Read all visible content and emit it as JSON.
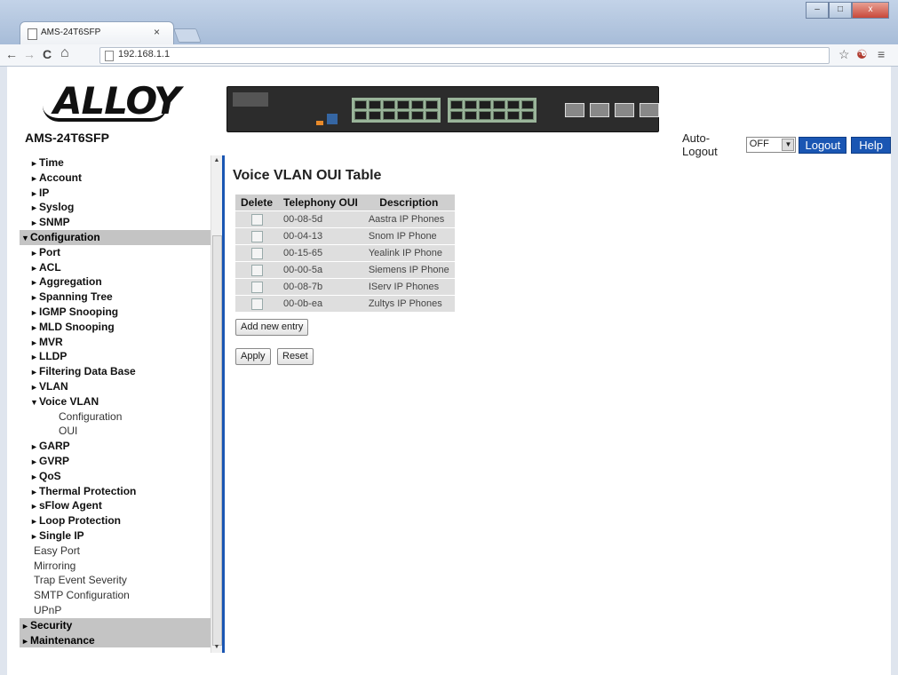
{
  "browser": {
    "tab_title": "AMS-24T6SFP",
    "tab_close": "×",
    "url": "192.168.1.1",
    "back_icon": "←",
    "forward_icon": "→",
    "reload_icon": "C",
    "home_icon": "⌂",
    "star_icon": "☆",
    "menu_icon": "≡",
    "ext_icon": "☯",
    "min_icon": "–",
    "max_icon": "□",
    "close_icon": "x"
  },
  "header": {
    "logo": "ALLOY",
    "model": "AMS-24T6SFP",
    "auto_logout_label": "Auto-Logout",
    "auto_logout_value": "OFF",
    "logout_label": "Logout",
    "help_label": "Help"
  },
  "sidebar": {
    "items": [
      {
        "label": "Time",
        "type": "b",
        "arrow": "►"
      },
      {
        "label": "Account",
        "type": "b",
        "arrow": "►"
      },
      {
        "label": "IP",
        "type": "b",
        "arrow": "►"
      },
      {
        "label": "Syslog",
        "type": "b",
        "arrow": "►"
      },
      {
        "label": "SNMP",
        "type": "b",
        "arrow": "►"
      },
      {
        "label": "Configuration",
        "type": "sec",
        "arrow": "▼"
      },
      {
        "label": "Port",
        "type": "b",
        "arrow": "►"
      },
      {
        "label": "ACL",
        "type": "b",
        "arrow": "►"
      },
      {
        "label": "Aggregation",
        "type": "b",
        "arrow": "►"
      },
      {
        "label": "Spanning Tree",
        "type": "b",
        "arrow": "►"
      },
      {
        "label": "IGMP Snooping",
        "type": "b",
        "arrow": "►"
      },
      {
        "label": "MLD Snooping",
        "type": "b",
        "arrow": "►"
      },
      {
        "label": "MVR",
        "type": "b",
        "arrow": "►"
      },
      {
        "label": "LLDP",
        "type": "b",
        "arrow": "►"
      },
      {
        "label": "Filtering Data Base",
        "type": "b",
        "arrow": "►"
      },
      {
        "label": "VLAN",
        "type": "b",
        "arrow": "►"
      },
      {
        "label": "Voice VLAN",
        "type": "b",
        "arrow": "▼"
      },
      {
        "label": "Configuration",
        "type": "sub",
        "arrow": ""
      },
      {
        "label": "OUI",
        "type": "sub",
        "arrow": ""
      },
      {
        "label": "GARP",
        "type": "b",
        "arrow": "►"
      },
      {
        "label": "GVRP",
        "type": "b",
        "arrow": "►"
      },
      {
        "label": "QoS",
        "type": "b",
        "arrow": "►"
      },
      {
        "label": "Thermal Protection",
        "type": "b",
        "arrow": "►"
      },
      {
        "label": "sFlow Agent",
        "type": "b",
        "arrow": "►"
      },
      {
        "label": "Loop Protection",
        "type": "b",
        "arrow": "►"
      },
      {
        "label": "Single IP",
        "type": "b",
        "arrow": "►"
      },
      {
        "label": "Easy Port",
        "type": "plain",
        "arrow": ""
      },
      {
        "label": "Mirroring",
        "type": "plain",
        "arrow": ""
      },
      {
        "label": "Trap Event Severity",
        "type": "plain",
        "arrow": ""
      },
      {
        "label": "SMTP Configuration",
        "type": "plain",
        "arrow": ""
      },
      {
        "label": "UPnP",
        "type": "plain",
        "arrow": ""
      },
      {
        "label": "Security",
        "type": "sec",
        "arrow": "►"
      },
      {
        "label": "Maintenance",
        "type": "sec",
        "arrow": "►"
      }
    ],
    "scroll_up": "▲",
    "scroll_down": "▼"
  },
  "main": {
    "title": "Voice VLAN OUI Table",
    "columns": [
      "Delete",
      "Telephony OUI",
      "Description"
    ],
    "rows": [
      {
        "oui": "00-08-5d",
        "description": "Aastra IP Phones"
      },
      {
        "oui": "00-04-13",
        "description": "Snom IP Phone"
      },
      {
        "oui": "00-15-65",
        "description": "Yealink IP Phone"
      },
      {
        "oui": "00-00-5a",
        "description": "Siemens IP Phone"
      },
      {
        "oui": "00-08-7b",
        "description": "IServ IP Phones"
      },
      {
        "oui": "00-0b-ea",
        "description": "Zultys IP Phones"
      }
    ],
    "add_entry_label": "Add new entry",
    "apply_label": "Apply",
    "reset_label": "Reset"
  },
  "colors": {
    "accent_blue": "#1a56b3",
    "section_gray": "#c4c4c4"
  }
}
